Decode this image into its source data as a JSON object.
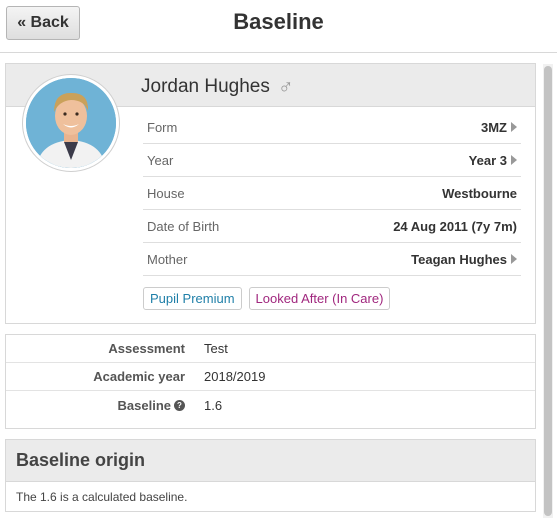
{
  "header": {
    "back_label": "« Back",
    "title": "Baseline"
  },
  "student": {
    "name": "Jordan Hughes",
    "gender_icon": "♂",
    "fields": [
      {
        "label": "Form",
        "value": "3MZ",
        "link": true
      },
      {
        "label": "Year",
        "value": "Year 3",
        "link": true
      },
      {
        "label": "House",
        "value": "Westbourne",
        "link": false
      },
      {
        "label": "Date of Birth",
        "value": "24 Aug 2011 (7y 7m)",
        "link": false
      },
      {
        "label": "Mother",
        "value": "Teagan Hughes",
        "link": true
      }
    ],
    "tags": {
      "pupil_premium": "Pupil Premium",
      "looked_after": "Looked After (In Care)"
    }
  },
  "details": {
    "assessment_label": "Assessment",
    "assessment_value": "Test",
    "academic_year_label": "Academic year",
    "academic_year_value": "2018/2019",
    "baseline_label": "Baseline",
    "baseline_help": "?",
    "baseline_value": "1.6"
  },
  "origin": {
    "title": "Baseline origin",
    "text": "The 1.6 is a calculated baseline."
  },
  "colors": {
    "pupil_premium": "#1f7fa8",
    "looked_after": "#a0277e",
    "band": "#ebebeb"
  }
}
